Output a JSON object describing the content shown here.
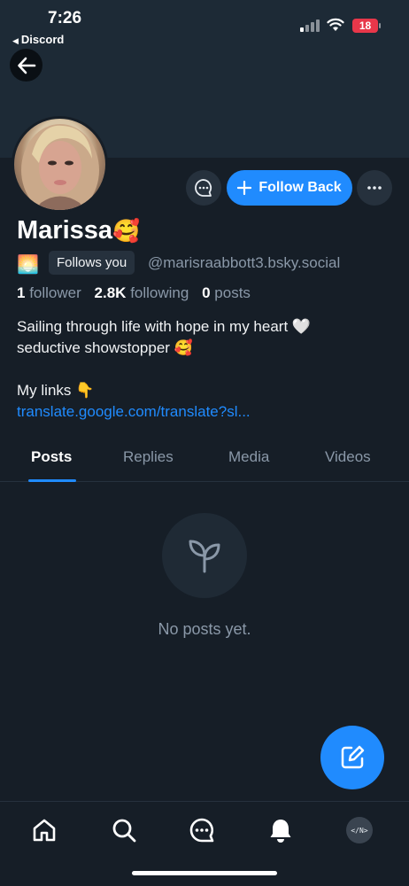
{
  "status_bar": {
    "time": "7:26",
    "back_app": "Discord",
    "battery": "18",
    "battery_color": "#e8374a"
  },
  "profile": {
    "name": "Marissa",
    "name_emoji": "🥰",
    "sun_emoji": "🌅",
    "follows_you": "Follows you",
    "handle": "@marisraabbott3.bsky.social",
    "stats": {
      "followers_count": "1",
      "followers_label": "follower",
      "following_count": "2.8K",
      "following_label": "following",
      "posts_count": "0",
      "posts_label": "posts"
    },
    "bio": {
      "line1": "Sailing through life with hope in my heart 🤍",
      "line2": "seductive showstopper 🥰",
      "line3": "My links 👇",
      "link": "translate.google.com/translate?sl..."
    }
  },
  "actions": {
    "follow_back": "Follow Back"
  },
  "tabs": [
    {
      "label": "Posts",
      "active": true
    },
    {
      "label": "Replies",
      "active": false
    },
    {
      "label": "Media",
      "active": false
    },
    {
      "label": "Videos",
      "active": false
    }
  ],
  "empty_state": {
    "text": "No posts yet.",
    "icon": "sprout-icon"
  },
  "bottom_nav": {
    "items": [
      "home-icon",
      "search-icon",
      "chat-icon",
      "bell-icon",
      "profile-avatar"
    ],
    "avatar_text": "</N>"
  },
  "colors": {
    "accent": "#208bfe",
    "background": "#161e27",
    "banner": "#1d2a36",
    "muted_text": "#8a98a8"
  }
}
